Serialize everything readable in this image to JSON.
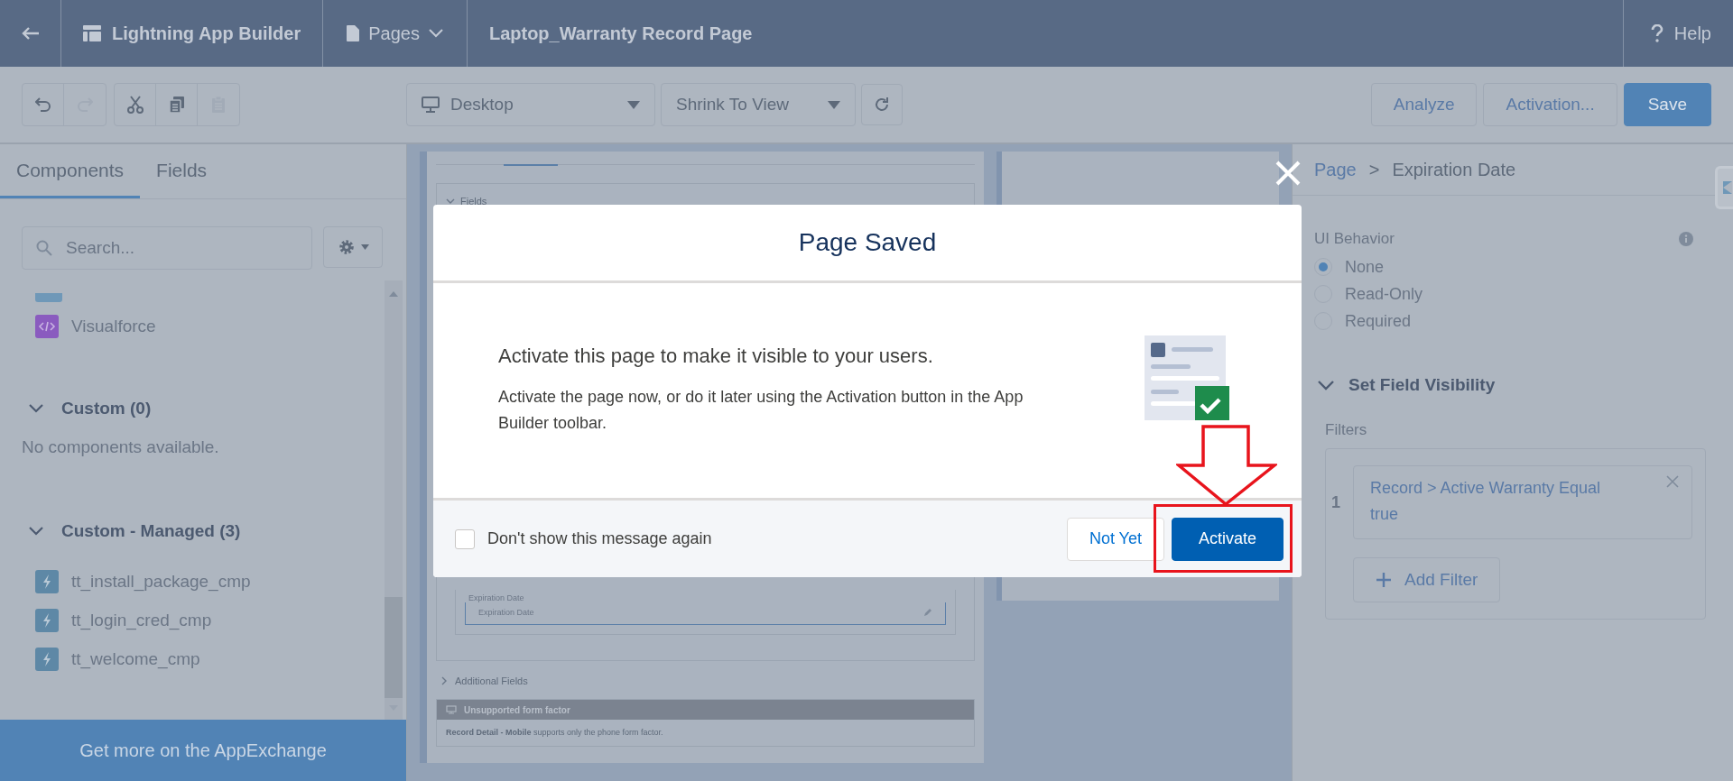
{
  "top_bar": {
    "app_name": "Lightning App Builder",
    "pages_menu": "Pages",
    "page_title": "Laptop_Warranty Record Page",
    "help": "Help"
  },
  "toolbar": {
    "edit_tools": [
      {
        "kind": "undo",
        "disabled": false
      },
      {
        "kind": "redo",
        "disabled": true
      },
      {
        "kind": "cut",
        "disabled": false
      },
      {
        "kind": "copy",
        "disabled": false
      },
      {
        "kind": "paste",
        "disabled": true
      }
    ],
    "device": "Desktop",
    "zoom": "Shrink To View",
    "buttons": [
      {
        "label": "Analyze",
        "kind": "neutral"
      },
      {
        "label": "Activation...",
        "kind": "neutral"
      },
      {
        "label": "Save",
        "kind": "brand"
      }
    ]
  },
  "left_panel": {
    "tabs": [
      {
        "label": "Components",
        "selected": true
      },
      {
        "label": "Fields",
        "selected": false
      }
    ],
    "search": {
      "placeholder": "Search..."
    },
    "items": [
      {
        "label": "Visualforce",
        "kind": "visualforce"
      }
    ],
    "sections": [
      {
        "title": "Custom (0)",
        "expanded": true,
        "empty_text": "No components available."
      },
      {
        "title": "Custom - Managed (3)",
        "expanded": true,
        "items": [
          {
            "label": "tt_install_package_cmp",
            "kind": "lightning"
          },
          {
            "label": "tt_login_cred_cmp",
            "kind": "lightning"
          },
          {
            "label": "tt_welcome_cmp",
            "kind": "lightning"
          }
        ]
      }
    ],
    "appexchange": "Get more on the AppExchange"
  },
  "canvas": {
    "fields_section": "Fields",
    "field_label": "Expiration Date",
    "field_value": "Expiration Date",
    "additional_fields": "Additional Fields",
    "warning": {
      "title": "Unsupported form factor",
      "message": "**Record Detail - Mobile** supports only the phone form factor."
    }
  },
  "right_panel": {
    "breadcrumb": {
      "parent": "Page",
      "separator": ">",
      "current": "Expiration Date"
    },
    "ui_behavior": {
      "label": "UI Behavior",
      "options": [
        {
          "label": "None",
          "selected": true
        },
        {
          "label": "Read-Only",
          "selected": false
        },
        {
          "label": "Required",
          "selected": false
        }
      ]
    },
    "visibility": {
      "title": "Set Field Visibility",
      "expanded": true,
      "filters_label": "Filters",
      "filters": [
        {
          "number": "1",
          "text": "Record > Active Warranty Equal true"
        }
      ],
      "add_button": "Add Filter"
    }
  },
  "modal": {
    "title": "Page Saved",
    "heading": "Activate this page to make it visible to your users.",
    "text": "Activate the page now, or do it later using the Activation button in the App Builder toolbar.",
    "checkbox": {
      "label": "Don't show this message again",
      "checked": false
    },
    "buttons": [
      {
        "label": "Not Yet",
        "kind": "neutral"
      },
      {
        "label": "Activate",
        "kind": "brand"
      }
    ]
  }
}
